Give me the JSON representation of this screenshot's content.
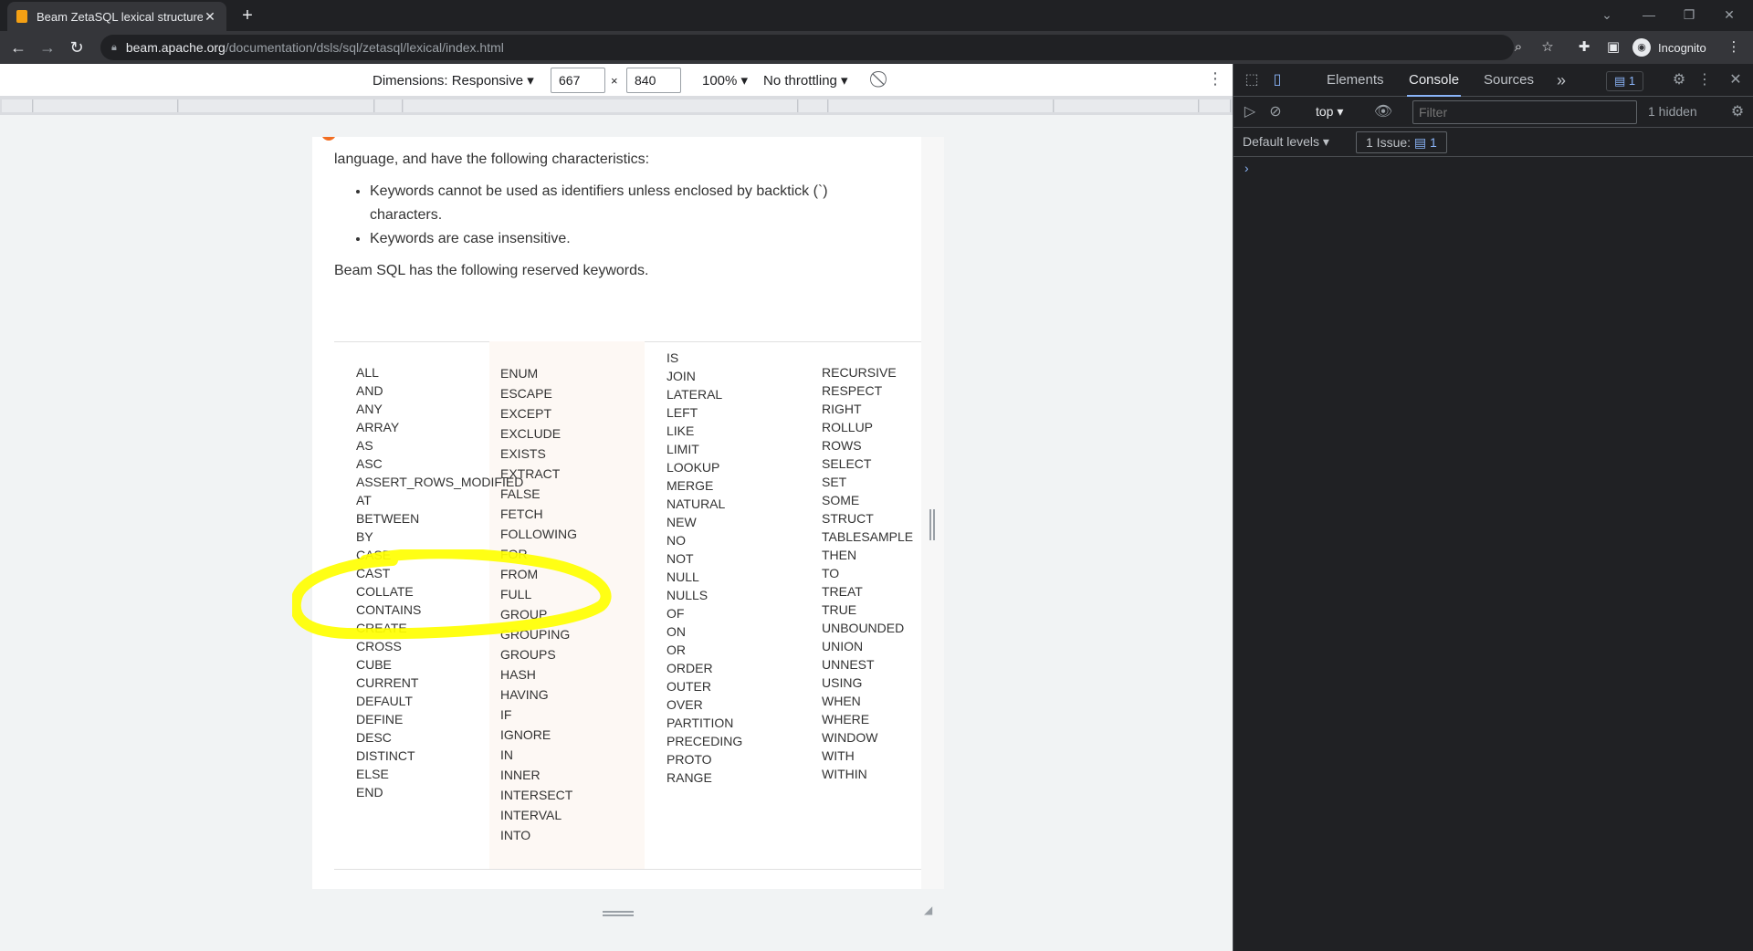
{
  "browser": {
    "tab_title": "Beam ZetaSQL lexical structure",
    "tab_close": "✕",
    "new_tab": "+",
    "url_host": "beam.apache.org",
    "url_path": "/documentation/dsls/sql/zetasql/lexical/index.html",
    "profile_label": "Incognito"
  },
  "device_toolbar": {
    "dimensions_label": "Dimensions: Responsive",
    "width": "667",
    "times": "×",
    "height": "840",
    "zoom": "100%",
    "throttling": "No throttling"
  },
  "page": {
    "intro": "language, and have the following characteristics:",
    "bullets": [
      "Keywords cannot be used as identifiers unless enclosed by backtick (`) characters.",
      "Keywords are case insensitive."
    ],
    "after": "Beam SQL has the following reserved keywords.",
    "keywords": {
      "col1": [
        "ALL",
        "AND",
        "ANY",
        "ARRAY",
        "AS",
        "ASC",
        "ASSERT_ROWS_MODIFIED",
        "AT",
        "BETWEEN",
        "BY",
        "CASE",
        "CAST",
        "COLLATE",
        "CONTAINS",
        "CREATE",
        "CROSS",
        "CUBE",
        "CURRENT",
        "DEFAULT",
        "DEFINE",
        "DESC",
        "DISTINCT",
        "ELSE",
        "END"
      ],
      "col2": [
        "ENUM",
        "ESCAPE",
        "EXCEPT",
        "EXCLUDE",
        "EXISTS",
        "EXTRACT",
        "FALSE",
        "FETCH",
        "FOLLOWING",
        "FOR",
        "FROM",
        "FULL",
        "GROUP",
        "GROUPING",
        "GROUPS",
        "HASH",
        "HAVING",
        "IF",
        "IGNORE",
        "IN",
        "INNER",
        "INTERSECT",
        "INTERVAL",
        "INTO"
      ],
      "col3": [
        "IS",
        "JOIN",
        "LATERAL",
        "LEFT",
        "LIKE",
        "LIMIT",
        "LOOKUP",
        "MERGE",
        "NATURAL",
        "NEW",
        "NO",
        "NOT",
        "NULL",
        "NULLS",
        "OF",
        "ON",
        "OR",
        "ORDER",
        "OUTER",
        "OVER",
        "PARTITION",
        "PRECEDING",
        "PROTO",
        "RANGE"
      ],
      "col4": [
        "RECURSIVE",
        "RESPECT",
        "RIGHT",
        "ROLLUP",
        "ROWS",
        "SELECT",
        "SET",
        "SOME",
        "STRUCT",
        "TABLESAMPLE",
        "THEN",
        "TO",
        "TREAT",
        "TRUE",
        "UNBOUNDED",
        "UNION",
        "UNNEST",
        "USING",
        "WHEN",
        "WHERE",
        "WINDOW",
        "WITH",
        "WITHIN"
      ]
    }
  },
  "devtools": {
    "tabs": [
      "Elements",
      "Console",
      "Sources"
    ],
    "active_tab": "Console",
    "more_tabs": "»",
    "messages_badge": "1",
    "context": "top",
    "filter_placeholder": "Filter",
    "hidden_count": "1 hidden",
    "levels": "Default levels",
    "issues_label": "1 Issue:",
    "issues_count": "1",
    "prompt": "›"
  },
  "colors": {
    "highlight": "#ffff00",
    "accent": "#8ab4f8",
    "beam_orange": "#f26d21"
  }
}
